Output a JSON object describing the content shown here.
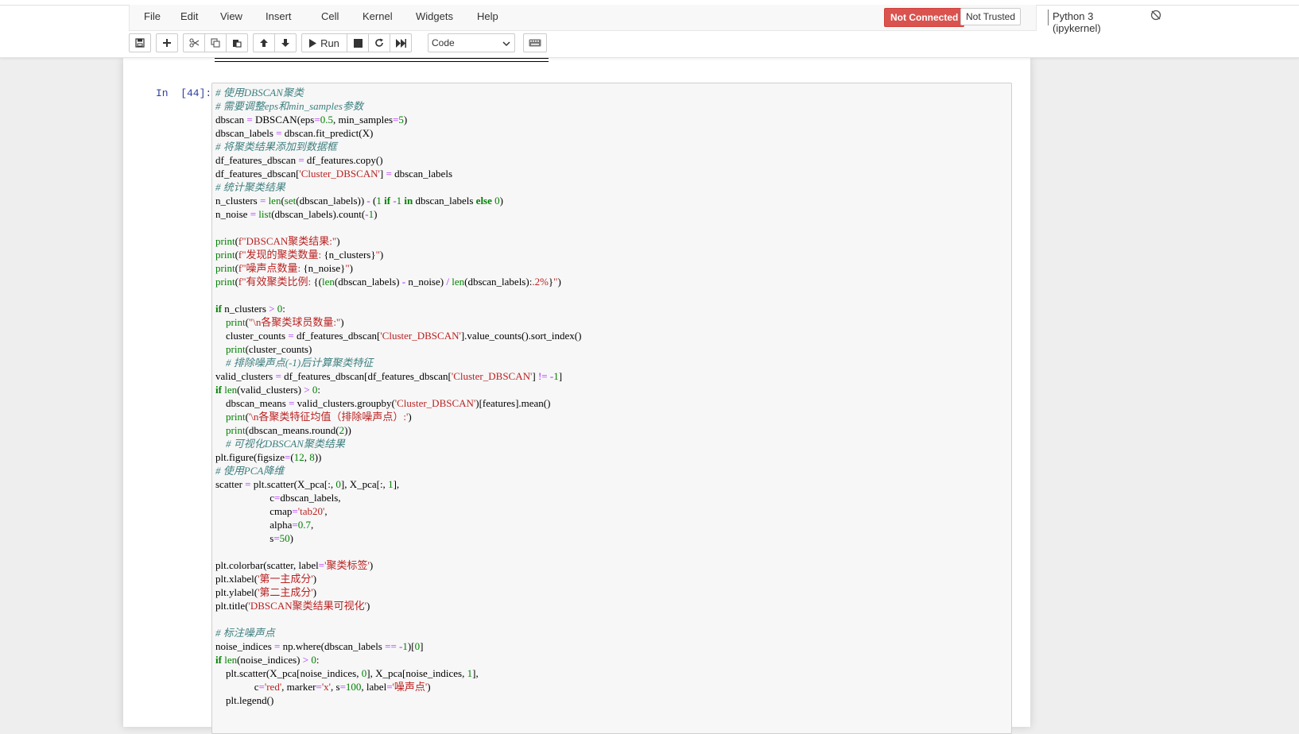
{
  "menubar": {
    "items": [
      "File",
      "Edit",
      "View",
      "Insert",
      "Cell",
      "Kernel",
      "Widgets",
      "Help"
    ],
    "status_not_connected": "Not Connected",
    "status_not_trusted": "Not Trusted",
    "kernel_name": "Python 3 (ipykernel)"
  },
  "toolbar": {
    "run_label": "Run",
    "cell_type": "Code"
  },
  "cell": {
    "prompt": "In  [44]:",
    "code_lines": [
      [
        [
          "comment",
          "# 使用DBSCAN聚类"
        ]
      ],
      [
        [
          "comment",
          "# 需要调整eps和min_samples参数"
        ]
      ],
      [
        [
          "plain",
          "dbscan "
        ],
        [
          "operator",
          "="
        ],
        [
          "plain",
          " DBSCAN(eps"
        ],
        [
          "operator",
          "="
        ],
        [
          "number",
          "0.5"
        ],
        [
          "plain",
          ", min_samples"
        ],
        [
          "operator",
          "="
        ],
        [
          "number",
          "5"
        ],
        [
          "plain",
          ")"
        ]
      ],
      [
        [
          "plain",
          "dbscan_labels "
        ],
        [
          "operator",
          "="
        ],
        [
          "plain",
          " dbscan.fit_predict(X)"
        ]
      ],
      [
        [
          "comment",
          "# 将聚类结果添加到数据框"
        ]
      ],
      [
        [
          "plain",
          "df_features_dbscan "
        ],
        [
          "operator",
          "="
        ],
        [
          "plain",
          " df_features.copy()"
        ]
      ],
      [
        [
          "plain",
          "df_features_dbscan["
        ],
        [
          "string",
          "'Cluster_DBSCAN'"
        ],
        [
          "plain",
          "] "
        ],
        [
          "operator",
          "="
        ],
        [
          "plain",
          " dbscan_labels"
        ]
      ],
      [
        [
          "comment",
          "# 统计聚类结果"
        ]
      ],
      [
        [
          "plain",
          "n_clusters "
        ],
        [
          "operator",
          "="
        ],
        [
          "plain",
          " "
        ],
        [
          "builtin",
          "len"
        ],
        [
          "plain",
          "("
        ],
        [
          "builtin",
          "set"
        ],
        [
          "plain",
          "(dbscan_labels)) "
        ],
        [
          "operator",
          "-"
        ],
        [
          "plain",
          " ("
        ],
        [
          "number",
          "1"
        ],
        [
          "plain",
          " "
        ],
        [
          "keyword",
          "if"
        ],
        [
          "plain",
          " "
        ],
        [
          "operator",
          "-"
        ],
        [
          "number",
          "1"
        ],
        [
          "plain",
          " "
        ],
        [
          "keyword",
          "in"
        ],
        [
          "plain",
          " dbscan_labels "
        ],
        [
          "keyword",
          "else"
        ],
        [
          "plain",
          " "
        ],
        [
          "number",
          "0"
        ],
        [
          "plain",
          ")"
        ]
      ],
      [
        [
          "plain",
          "n_noise "
        ],
        [
          "operator",
          "="
        ],
        [
          "plain",
          " "
        ],
        [
          "builtin",
          "list"
        ],
        [
          "plain",
          "(dbscan_labels).count("
        ],
        [
          "operator",
          "-"
        ],
        [
          "number",
          "1"
        ],
        [
          "plain",
          ")"
        ]
      ],
      [],
      [
        [
          "builtin",
          "print"
        ],
        [
          "plain",
          "("
        ],
        [
          "string",
          "f\"DBSCAN聚类结果:\""
        ],
        [
          "plain",
          ")"
        ]
      ],
      [
        [
          "builtin",
          "print"
        ],
        [
          "plain",
          "("
        ],
        [
          "string",
          "f\"发现的聚类数量: "
        ],
        [
          "plain",
          "{n_clusters}"
        ],
        [
          "string",
          "\""
        ],
        [
          "plain",
          ")"
        ]
      ],
      [
        [
          "builtin",
          "print"
        ],
        [
          "plain",
          "("
        ],
        [
          "string",
          "f\"噪声点数量: "
        ],
        [
          "plain",
          "{n_noise}"
        ],
        [
          "string",
          "\""
        ],
        [
          "plain",
          ")"
        ]
      ],
      [
        [
          "builtin",
          "print"
        ],
        [
          "plain",
          "("
        ],
        [
          "string",
          "f\"有效聚类比例: "
        ],
        [
          "plain",
          "{("
        ],
        [
          "builtin",
          "len"
        ],
        [
          "plain",
          "(dbscan_labels) "
        ],
        [
          "operator",
          "-"
        ],
        [
          "plain",
          " n_noise) "
        ],
        [
          "operator",
          "/"
        ],
        [
          "plain",
          " "
        ],
        [
          "builtin",
          "len"
        ],
        [
          "plain",
          "(dbscan_labels):"
        ],
        [
          "string",
          ".2%"
        ],
        [
          "plain",
          "}"
        ],
        [
          "string",
          "\""
        ],
        [
          "plain",
          ")"
        ]
      ],
      [],
      [
        [
          "keyword",
          "if"
        ],
        [
          "plain",
          " n_clusters "
        ],
        [
          "operator",
          ">"
        ],
        [
          "plain",
          " "
        ],
        [
          "number",
          "0"
        ],
        [
          "plain",
          ":"
        ]
      ],
      [
        [
          "plain",
          "    "
        ],
        [
          "builtin",
          "print"
        ],
        [
          "plain",
          "("
        ],
        [
          "string",
          "\"\\n各聚类球员数量:\""
        ],
        [
          "plain",
          ")"
        ]
      ],
      [
        [
          "plain",
          "    cluster_counts "
        ],
        [
          "operator",
          "="
        ],
        [
          "plain",
          " df_features_dbscan["
        ],
        [
          "string",
          "'Cluster_DBSCAN'"
        ],
        [
          "plain",
          "].value_counts().sort_index()"
        ]
      ],
      [
        [
          "plain",
          "    "
        ],
        [
          "builtin",
          "print"
        ],
        [
          "plain",
          "(cluster_counts)"
        ]
      ],
      [
        [
          "plain",
          "    "
        ],
        [
          "comment",
          "# 排除噪声点(-1)后计算聚类特征"
        ]
      ],
      [
        [
          "plain",
          "valid_clusters "
        ],
        [
          "operator",
          "="
        ],
        [
          "plain",
          " df_features_dbscan[df_features_dbscan["
        ],
        [
          "string",
          "'Cluster_DBSCAN'"
        ],
        [
          "plain",
          "] "
        ],
        [
          "operator",
          "!="
        ],
        [
          "plain",
          " "
        ],
        [
          "operator",
          "-"
        ],
        [
          "number",
          "1"
        ],
        [
          "plain",
          "]"
        ]
      ],
      [
        [
          "keyword",
          "if"
        ],
        [
          "plain",
          " "
        ],
        [
          "builtin",
          "len"
        ],
        [
          "plain",
          "(valid_clusters) "
        ],
        [
          "operator",
          ">"
        ],
        [
          "plain",
          " "
        ],
        [
          "number",
          "0"
        ],
        [
          "plain",
          ":"
        ]
      ],
      [
        [
          "plain",
          "    dbscan_means "
        ],
        [
          "operator",
          "="
        ],
        [
          "plain",
          " valid_clusters.groupby("
        ],
        [
          "string",
          "'Cluster_DBSCAN'"
        ],
        [
          "plain",
          ")[features].mean()"
        ]
      ],
      [
        [
          "plain",
          "    "
        ],
        [
          "builtin",
          "print"
        ],
        [
          "plain",
          "("
        ],
        [
          "string",
          "'\\n各聚类特征均值（排除噪声点）:'"
        ],
        [
          "plain",
          ")"
        ]
      ],
      [
        [
          "plain",
          "    "
        ],
        [
          "builtin",
          "print"
        ],
        [
          "plain",
          "(dbscan_means.round("
        ],
        [
          "number",
          "2"
        ],
        [
          "plain",
          "))"
        ]
      ],
      [
        [
          "plain",
          "    "
        ],
        [
          "comment",
          "# 可视化DBSCAN聚类结果"
        ]
      ],
      [
        [
          "plain",
          "plt.figure(figsize"
        ],
        [
          "operator",
          "="
        ],
        [
          "plain",
          "("
        ],
        [
          "number",
          "12"
        ],
        [
          "plain",
          ", "
        ],
        [
          "number",
          "8"
        ],
        [
          "plain",
          "))"
        ]
      ],
      [
        [
          "comment",
          "# 使用PCA降维"
        ]
      ],
      [
        [
          "plain",
          "scatter "
        ],
        [
          "operator",
          "="
        ],
        [
          "plain",
          " plt.scatter(X_pca[:, "
        ],
        [
          "number",
          "0"
        ],
        [
          "plain",
          "], X_pca[:, "
        ],
        [
          "number",
          "1"
        ],
        [
          "plain",
          "],"
        ]
      ],
      [
        [
          "plain",
          "                     c"
        ],
        [
          "operator",
          "="
        ],
        [
          "plain",
          "dbscan_labels,"
        ]
      ],
      [
        [
          "plain",
          "                     cmap"
        ],
        [
          "operator",
          "="
        ],
        [
          "string",
          "'tab20'"
        ],
        [
          "plain",
          ","
        ]
      ],
      [
        [
          "plain",
          "                     alpha"
        ],
        [
          "operator",
          "="
        ],
        [
          "number",
          "0.7"
        ],
        [
          "plain",
          ","
        ]
      ],
      [
        [
          "plain",
          "                     s"
        ],
        [
          "operator",
          "="
        ],
        [
          "number",
          "50"
        ],
        [
          "plain",
          ")"
        ]
      ],
      [],
      [
        [
          "plain",
          "plt.colorbar(scatter, label"
        ],
        [
          "operator",
          "="
        ],
        [
          "string",
          "'聚类标签'"
        ],
        [
          "plain",
          ")"
        ]
      ],
      [
        [
          "plain",
          "plt.xlabel("
        ],
        [
          "string",
          "'第一主成分'"
        ],
        [
          "plain",
          ")"
        ]
      ],
      [
        [
          "plain",
          "plt.ylabel("
        ],
        [
          "string",
          "'第二主成分'"
        ],
        [
          "plain",
          ")"
        ]
      ],
      [
        [
          "plain",
          "plt.title("
        ],
        [
          "string",
          "'DBSCAN聚类结果可视化'"
        ],
        [
          "plain",
          ")"
        ]
      ],
      [],
      [
        [
          "comment",
          "# 标注噪声点"
        ]
      ],
      [
        [
          "plain",
          "noise_indices "
        ],
        [
          "operator",
          "="
        ],
        [
          "plain",
          " np.where(dbscan_labels "
        ],
        [
          "operator",
          "=="
        ],
        [
          "plain",
          " "
        ],
        [
          "operator",
          "-"
        ],
        [
          "number",
          "1"
        ],
        [
          "plain",
          ")["
        ],
        [
          "number",
          "0"
        ],
        [
          "plain",
          "]"
        ]
      ],
      [
        [
          "keyword",
          "if"
        ],
        [
          "plain",
          " "
        ],
        [
          "builtin",
          "len"
        ],
        [
          "plain",
          "(noise_indices) "
        ],
        [
          "operator",
          ">"
        ],
        [
          "plain",
          " "
        ],
        [
          "number",
          "0"
        ],
        [
          "plain",
          ":"
        ]
      ],
      [
        [
          "plain",
          "    plt.scatter(X_pca[noise_indices, "
        ],
        [
          "number",
          "0"
        ],
        [
          "plain",
          "], X_pca[noise_indices, "
        ],
        [
          "number",
          "1"
        ],
        [
          "plain",
          "],"
        ]
      ],
      [
        [
          "plain",
          "               c"
        ],
        [
          "operator",
          "="
        ],
        [
          "string",
          "'red'"
        ],
        [
          "plain",
          ", marker"
        ],
        [
          "operator",
          "="
        ],
        [
          "string",
          "'x'"
        ],
        [
          "plain",
          ", s"
        ],
        [
          "operator",
          "="
        ],
        [
          "number",
          "100"
        ],
        [
          "plain",
          ", label"
        ],
        [
          "operator",
          "="
        ],
        [
          "string",
          "'噪声点'"
        ],
        [
          "plain",
          ")"
        ]
      ],
      [
        [
          "plain",
          "    plt.legend()"
        ]
      ]
    ]
  },
  "colors": {
    "not_connected_bg": "#d9534f",
    "prompt": "#303f9f",
    "comment": "#408080",
    "keyword": "#008000",
    "string": "#ba2121",
    "operator": "#aa22ff"
  }
}
